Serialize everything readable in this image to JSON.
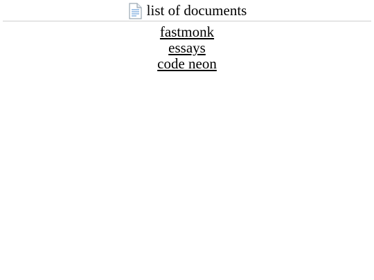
{
  "header": {
    "icon": "document-icon",
    "title": "list of documents"
  },
  "documents": [
    {
      "label": "fastmonk"
    },
    {
      "label": "essays"
    },
    {
      "label": "code neon"
    }
  ]
}
